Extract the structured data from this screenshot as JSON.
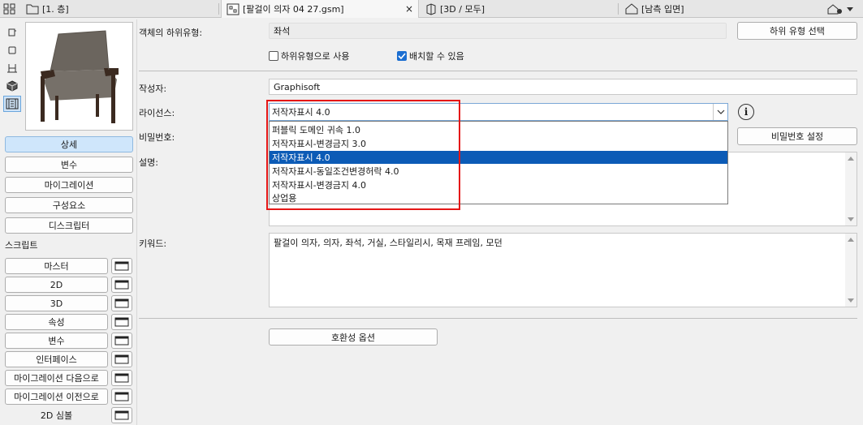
{
  "tabs": [
    {
      "label": "[1. 층]",
      "icon": "floor-plan-icon"
    },
    {
      "label": "[팔걸이 의자 04 27.gsm]",
      "icon": "gdl-object-icon",
      "close": "×"
    },
    {
      "label": "[3D / 모두]",
      "icon": "3d-view-icon"
    },
    {
      "label": "[남측 입면]",
      "icon": "elevation-icon"
    }
  ],
  "side_icons": [
    "2d-symbol-icon",
    "2d-icon",
    "chair-icon",
    "3d-cube-icon",
    "parameters-icon"
  ],
  "nav": {
    "details": "상세",
    "params": "변수",
    "migration": "마이그레이션",
    "components": "구성요소",
    "descriptors": "디스크립터"
  },
  "scripts": {
    "header": "스크립트",
    "items": [
      "마스터",
      "2D",
      "3D",
      "속성",
      "변수",
      "인터페이스",
      "마이그레이션 다음으로",
      "마이그레이션 이전으로",
      "2D 심볼"
    ]
  },
  "form": {
    "subtype_label": "객체의 하위유형:",
    "subtype_value": "좌석",
    "subtype_button": "하위 유형 선택",
    "use_as_subtype": "하위유형으로 사용",
    "placeable": "배치할 수 있음",
    "author_label": "작성자:",
    "author_value": "Graphisoft",
    "license_label": "라이선스:",
    "license_value": "저작자표시 4.0",
    "password_label": "비밀번호:",
    "password_button": "비밀번호 설정",
    "description_label": "설명:",
    "keywords_label": "키워드:",
    "keywords_value": "팔걸이 의자, 의자, 좌석, 거실, 스타일리시, 목재 프레임, 모던",
    "compat_button": "호환성 옵션"
  },
  "license_options": [
    "퍼블릭 도메인 귀속 1.0",
    "저작자표시-변경금지 3.0",
    "저작자표시 4.0",
    "저작자표시-동일조건변경허락 4.0",
    "저작자표시-변경금지 4.0",
    "상업용"
  ],
  "colors": {
    "highlight": "#e51616",
    "selection": "#0c5bb6",
    "checkbox": "#1b6ed1"
  }
}
